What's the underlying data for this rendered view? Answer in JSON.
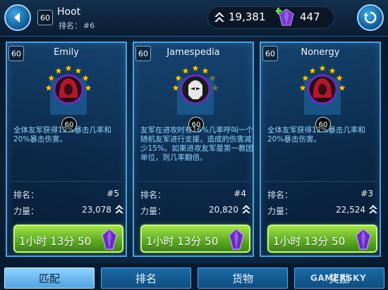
{
  "header": {
    "player_level": "60",
    "player_name": "Hoot",
    "rank_label": "排名：",
    "rank_value": "#6",
    "credits": "19,381",
    "crystals": "447"
  },
  "opponents": [
    {
      "level": "60",
      "name": "Emily",
      "character_level": "60",
      "stars": 7,
      "description": "全体友军获得12%暴击几率和20%暴击伤害。",
      "rank_label": "排名：",
      "rank_value": "#5",
      "power_label": "力量：",
      "power_value": "23,078",
      "timer": "1小时 13分 50"
    },
    {
      "level": "60",
      "name": "Jamespedia",
      "character_level": "60",
      "stars": 5,
      "description": "友军在进攻时有16%几率呼叫一个随机友军进行支援，造成的伤害减少15%。如果进攻友军是第一教团单位，则几率翻倍。",
      "rank_label": "排名：",
      "rank_value": "#4",
      "power_label": "力量：",
      "power_value": "20,820",
      "timer": "1小时 13分 50"
    },
    {
      "level": "60",
      "name": "Nonergy",
      "character_level": "60",
      "stars": 7,
      "description": "全体友军获得12%暴击几率和20%暴击伤害。",
      "rank_label": "排名：",
      "rank_value": "#3",
      "power_label": "力量：",
      "power_value": "22,524",
      "timer": "1小时 13分 50"
    }
  ],
  "tabs": [
    "匹配",
    "排名",
    "货物",
    "奖励"
  ],
  "active_tab": "匹配",
  "watermark": "GAMERSKY",
  "colors": {
    "card_border": "#4fa0df",
    "description_text": "#8fd4ff",
    "timer_green": "#5fae24",
    "crystal_purple": "#7a3ad0",
    "star_gold": "#f5c518"
  },
  "icons": {
    "back": "back-arrow-icon",
    "credits": "chevron-credits-icon",
    "crystal": "crystal-icon",
    "refresh": "refresh-icon",
    "power": "power-chevron-icon"
  }
}
